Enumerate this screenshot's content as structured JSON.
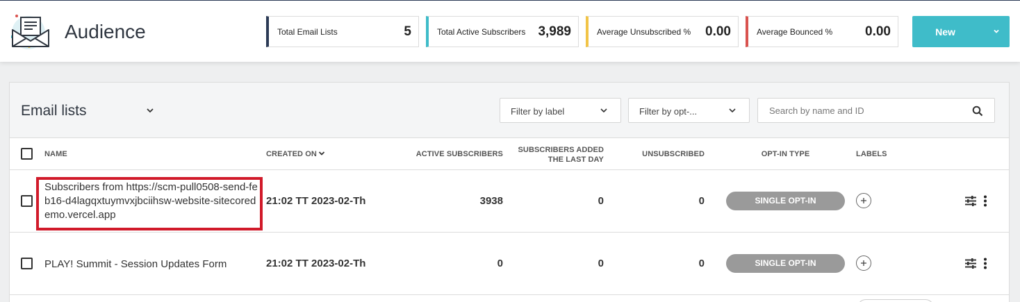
{
  "header": {
    "title": "Audience",
    "logo_icon": "envelope-icon",
    "stats": [
      {
        "label": "Total Email Lists",
        "value": "5",
        "color": "#2b3a55"
      },
      {
        "label": "Total Active Subscribers",
        "value": "3,989",
        "color": "#3fbcc9"
      },
      {
        "label": "Average Unsubscribed %",
        "value": "0.00",
        "color": "#f2c447"
      },
      {
        "label": "Average Bounced %",
        "value": "0.00",
        "color": "#d9534f"
      }
    ],
    "new_button": {
      "label": "New",
      "icon": "chevron-down-icon"
    }
  },
  "panel": {
    "title": "Email lists",
    "filters": {
      "label": "Filter by label",
      "optin": "Filter by opt-..."
    },
    "search": {
      "placeholder": "Search by name and ID",
      "value": "",
      "icon": "search-icon"
    },
    "columns": {
      "name": "NAME",
      "created_on": "CREATED ON",
      "active": "ACTIVE SUBSCRIBERS",
      "added_line1": "SUBSCRIBERS ADDED",
      "added_line2": "THE LAST DAY",
      "unsub": "UNSUBSCRIBED",
      "optin": "OPT-IN TYPE",
      "labels": "LABELS"
    },
    "rows": [
      {
        "name": "Subscribers from https://scm-pull0508-send-feb16-d4lagqxtuymvxjbciihsw-website-sitecoredemo.vercel.app",
        "created_on": "21:02 TT 2023-02-Th",
        "active": "3938",
        "added": "0",
        "unsubscribed": "0",
        "optin": "SINGLE OPT-IN",
        "highlight_color": "#d11a2a"
      },
      {
        "name": "PLAY! Summit - Session Updates Form",
        "created_on": "21:02 TT 2023-02-Th",
        "active": "0",
        "added": "0",
        "unsubscribed": "0",
        "optin": "SINGLE OPT-IN"
      }
    ]
  }
}
